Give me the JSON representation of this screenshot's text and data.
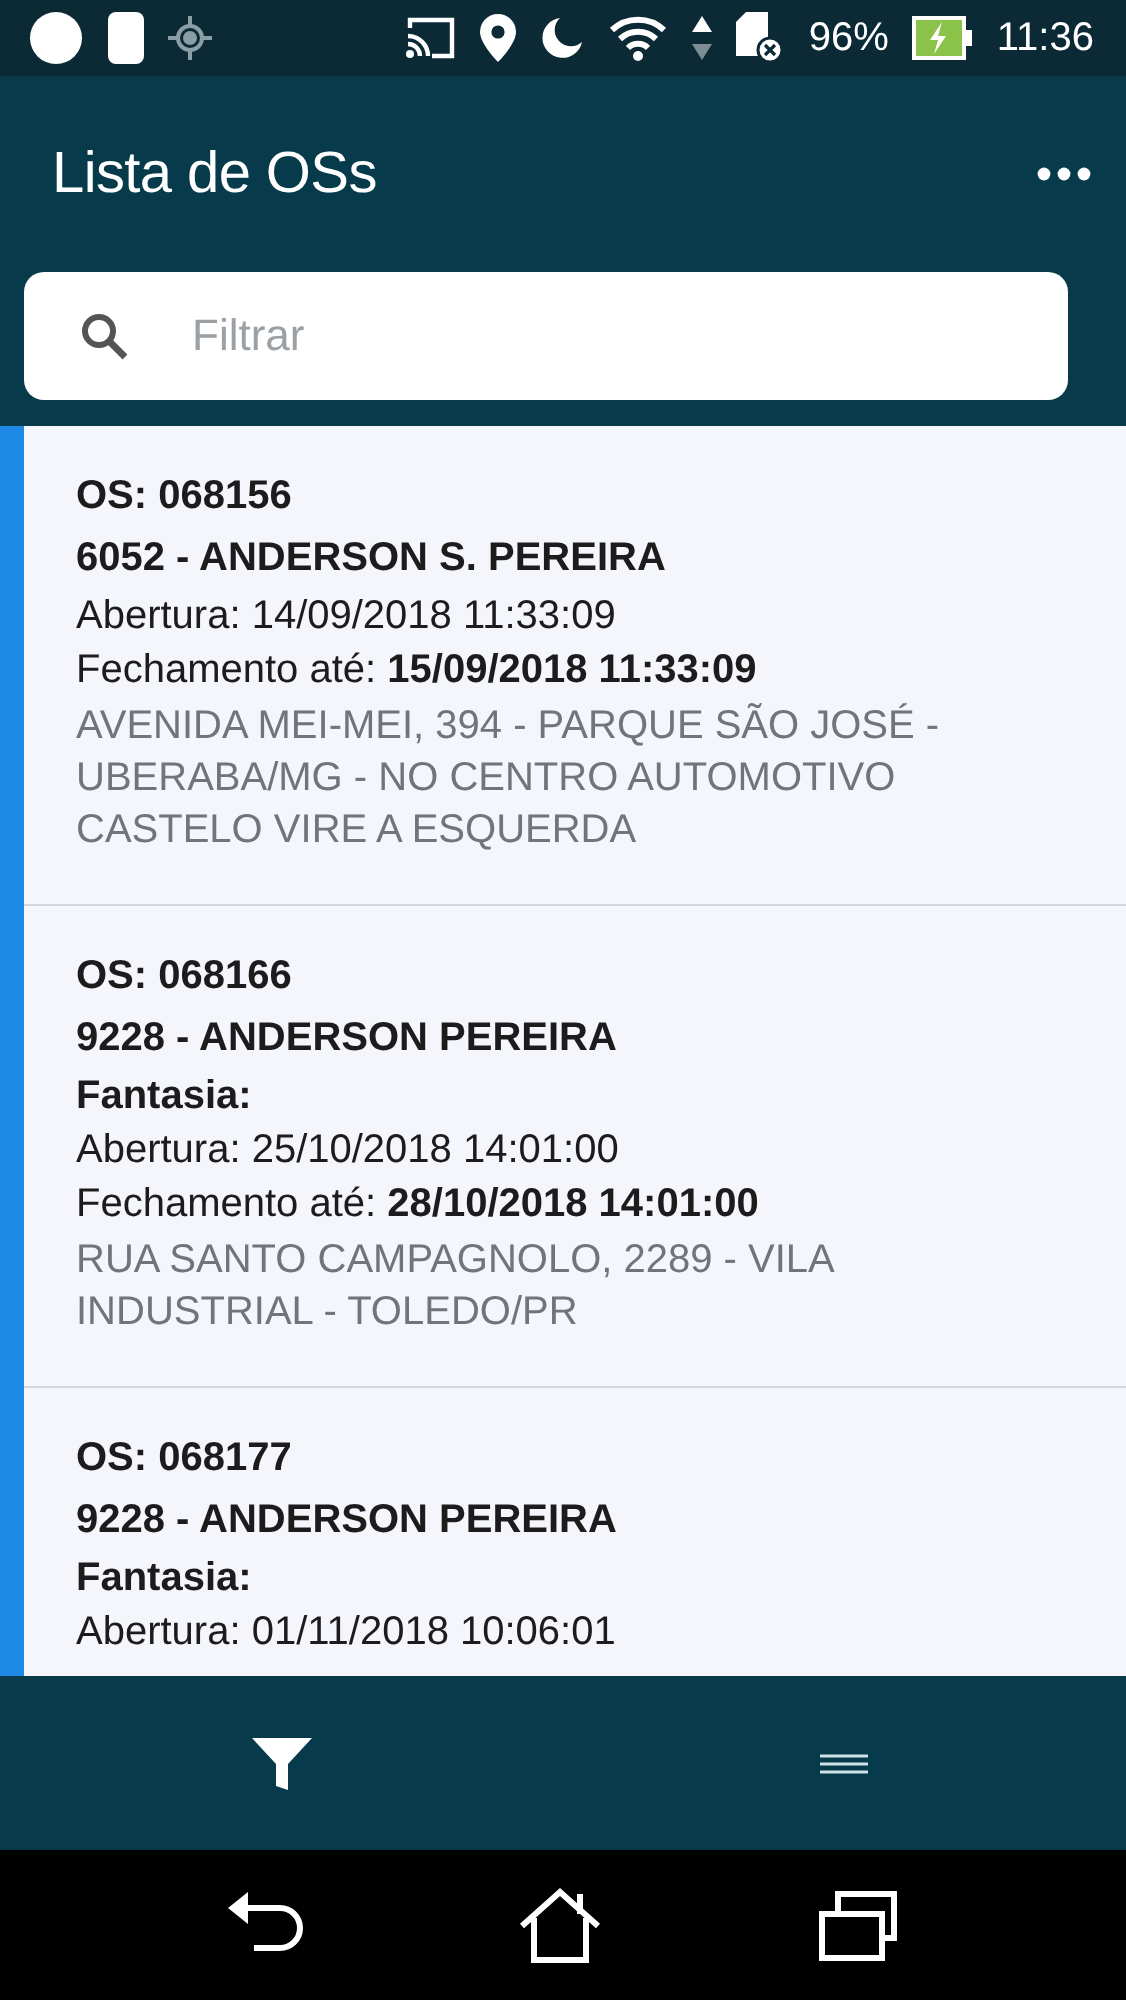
{
  "status_bar": {
    "battery": "96%",
    "time": "11:36"
  },
  "app_bar": {
    "title": "Lista de OSs"
  },
  "search": {
    "placeholder": "Filtrar"
  },
  "orders": [
    {
      "os": "OS: 068156",
      "client": "6052 - ANDERSON S. PEREIRA",
      "abertura": "Abertura: 14/09/2018 11:33:09",
      "fechamento": "Fechamento até: **15/09/2018 11:33:09**",
      "address": "AVENIDA MEI-MEI, 394 - PARQUE SÃO JOSÉ - UBERABA/MG - NO CENTRO AUTOMOTIVO CASTELO VIRE A ESQUERDA"
    },
    {
      "os": "OS: 068166",
      "client": "9228 - ANDERSON PEREIRA",
      "fantasia": "Fantasia:",
      "abertura": "Abertura: 25/10/2018 14:01:00",
      "fechamento": "Fechamento até: **28/10/2018 14:01:00**",
      "address": "RUA SANTO CAMPAGNOLO, 2289 - VILA INDUSTRIAL - TOLEDO/PR"
    },
    {
      "os": "OS: 068177",
      "client": "9228 - ANDERSON PEREIRA",
      "fantasia": "Fantasia:",
      "abertura": "Abertura: 01/11/2018 10:06:01"
    }
  ]
}
